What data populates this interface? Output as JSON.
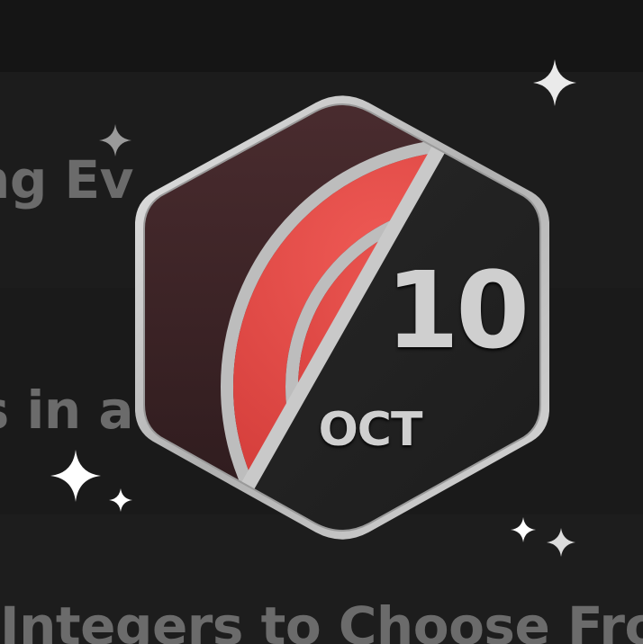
{
  "background_rows": [
    {
      "text": "oping Ev"
    },
    {
      "text": "s in a"
    },
    {
      "text": "Integers to Choose From a"
    }
  ],
  "badge": {
    "day": "10",
    "month": "OCT",
    "icon": "activity-rings-icon",
    "colors": {
      "frame": "#c4c4c4",
      "left_panel": "#3a2326",
      "right_panel": "#222222",
      "arc_fill": "#d9403f"
    }
  },
  "sparkles": {
    "icon": "sparkle-icon",
    "color": "#ffffff"
  }
}
